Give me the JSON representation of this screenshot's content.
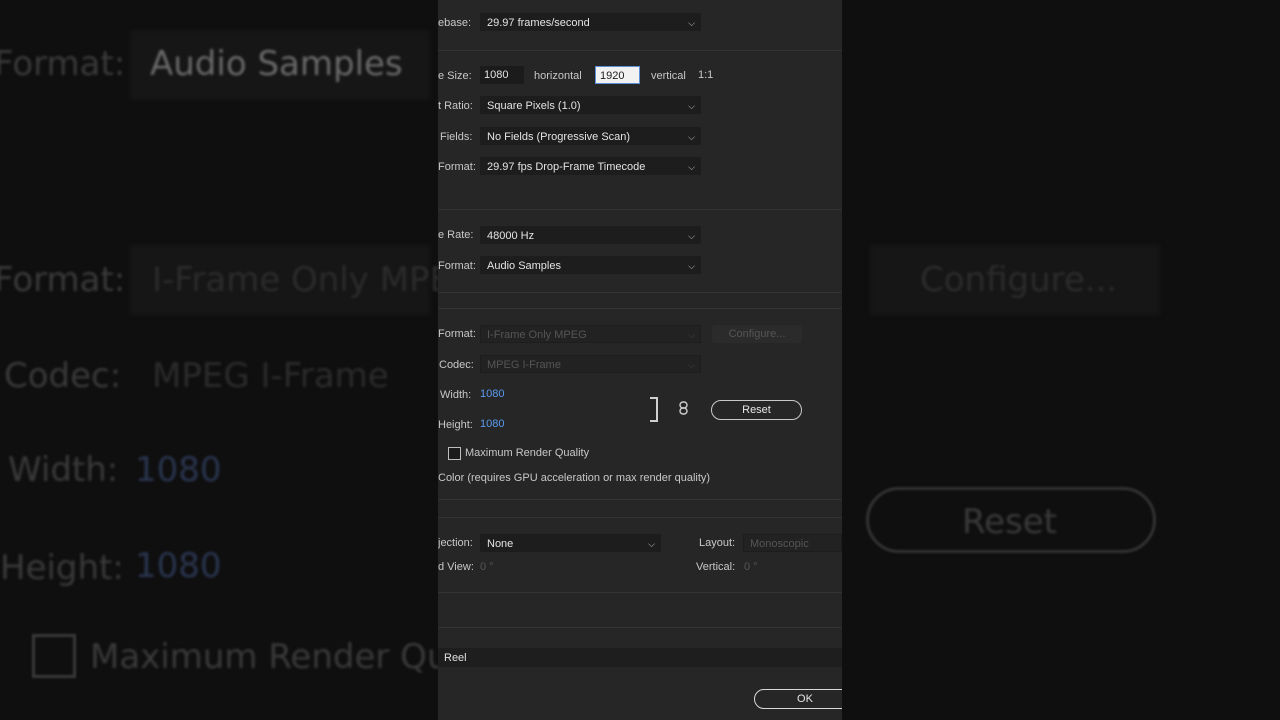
{
  "background": {
    "audio_format_label": "Format:",
    "audio_format_value": "Audio Samples",
    "video_format_label": "Format:",
    "video_format_value": "I-Frame Only MPEG",
    "codec_label": "Codec:",
    "codec_value": "MPEG I-Frame",
    "width_label": "Width:",
    "width_value": "1080",
    "height_label": "Height:",
    "height_value": "1080",
    "max_quality_label": "Maximum Render Qua",
    "configure_label": "Configure...",
    "reset_label": "Reset"
  },
  "video": {
    "timebase_label": "ebase:",
    "timebase_value": "29.97  frames/second",
    "frame_size_label": "e Size:",
    "frame_size_h": "1080",
    "horizontal_label": "horizontal",
    "frame_size_v": "1920",
    "vertical_label": "vertical",
    "ratio": "1:1",
    "pixel_aspect_label": "t Ratio:",
    "pixel_aspect_value": "Square Pixels (1.0)",
    "fields_label": "Fields:",
    "fields_value": "No Fields (Progressive Scan)",
    "display_format_label": "Format:",
    "display_format_value": "29.97 fps Drop-Frame Timecode"
  },
  "audio": {
    "sample_rate_label": "e Rate:",
    "sample_rate_value": "48000 Hz",
    "display_format_label": "Format:",
    "display_format_value": "Audio Samples"
  },
  "preview": {
    "file_format_label": "Format:",
    "file_format_value": "I-Frame Only MPEG",
    "configure_label": "Configure...",
    "codec_label": "Codec:",
    "codec_value": "MPEG I-Frame",
    "width_label": "Width:",
    "width_value": "1080",
    "height_label": "Height:",
    "height_value": "1080",
    "reset_label": "Reset",
    "max_quality_label": "Maximum Render Quality",
    "color_note": "Color (requires GPU acceleration or max render quality)"
  },
  "vr": {
    "projection_label": "jection:",
    "projection_value": "None",
    "layout_label": "Layout:",
    "layout_value": "Monoscopic",
    "captured_view_label": "d View:",
    "captured_view_value": "0 °",
    "vertical_label": "Vertical:",
    "vertical_value": "0 °"
  },
  "footer": {
    "reel_label": "Reel",
    "ok_label": "OK"
  },
  "icons": {
    "chevron": "chevron-down-icon",
    "link": "link-chain-icon"
  },
  "colors": {
    "dialog_bg": "#262626",
    "accent_blue": "#5b9bf0"
  }
}
